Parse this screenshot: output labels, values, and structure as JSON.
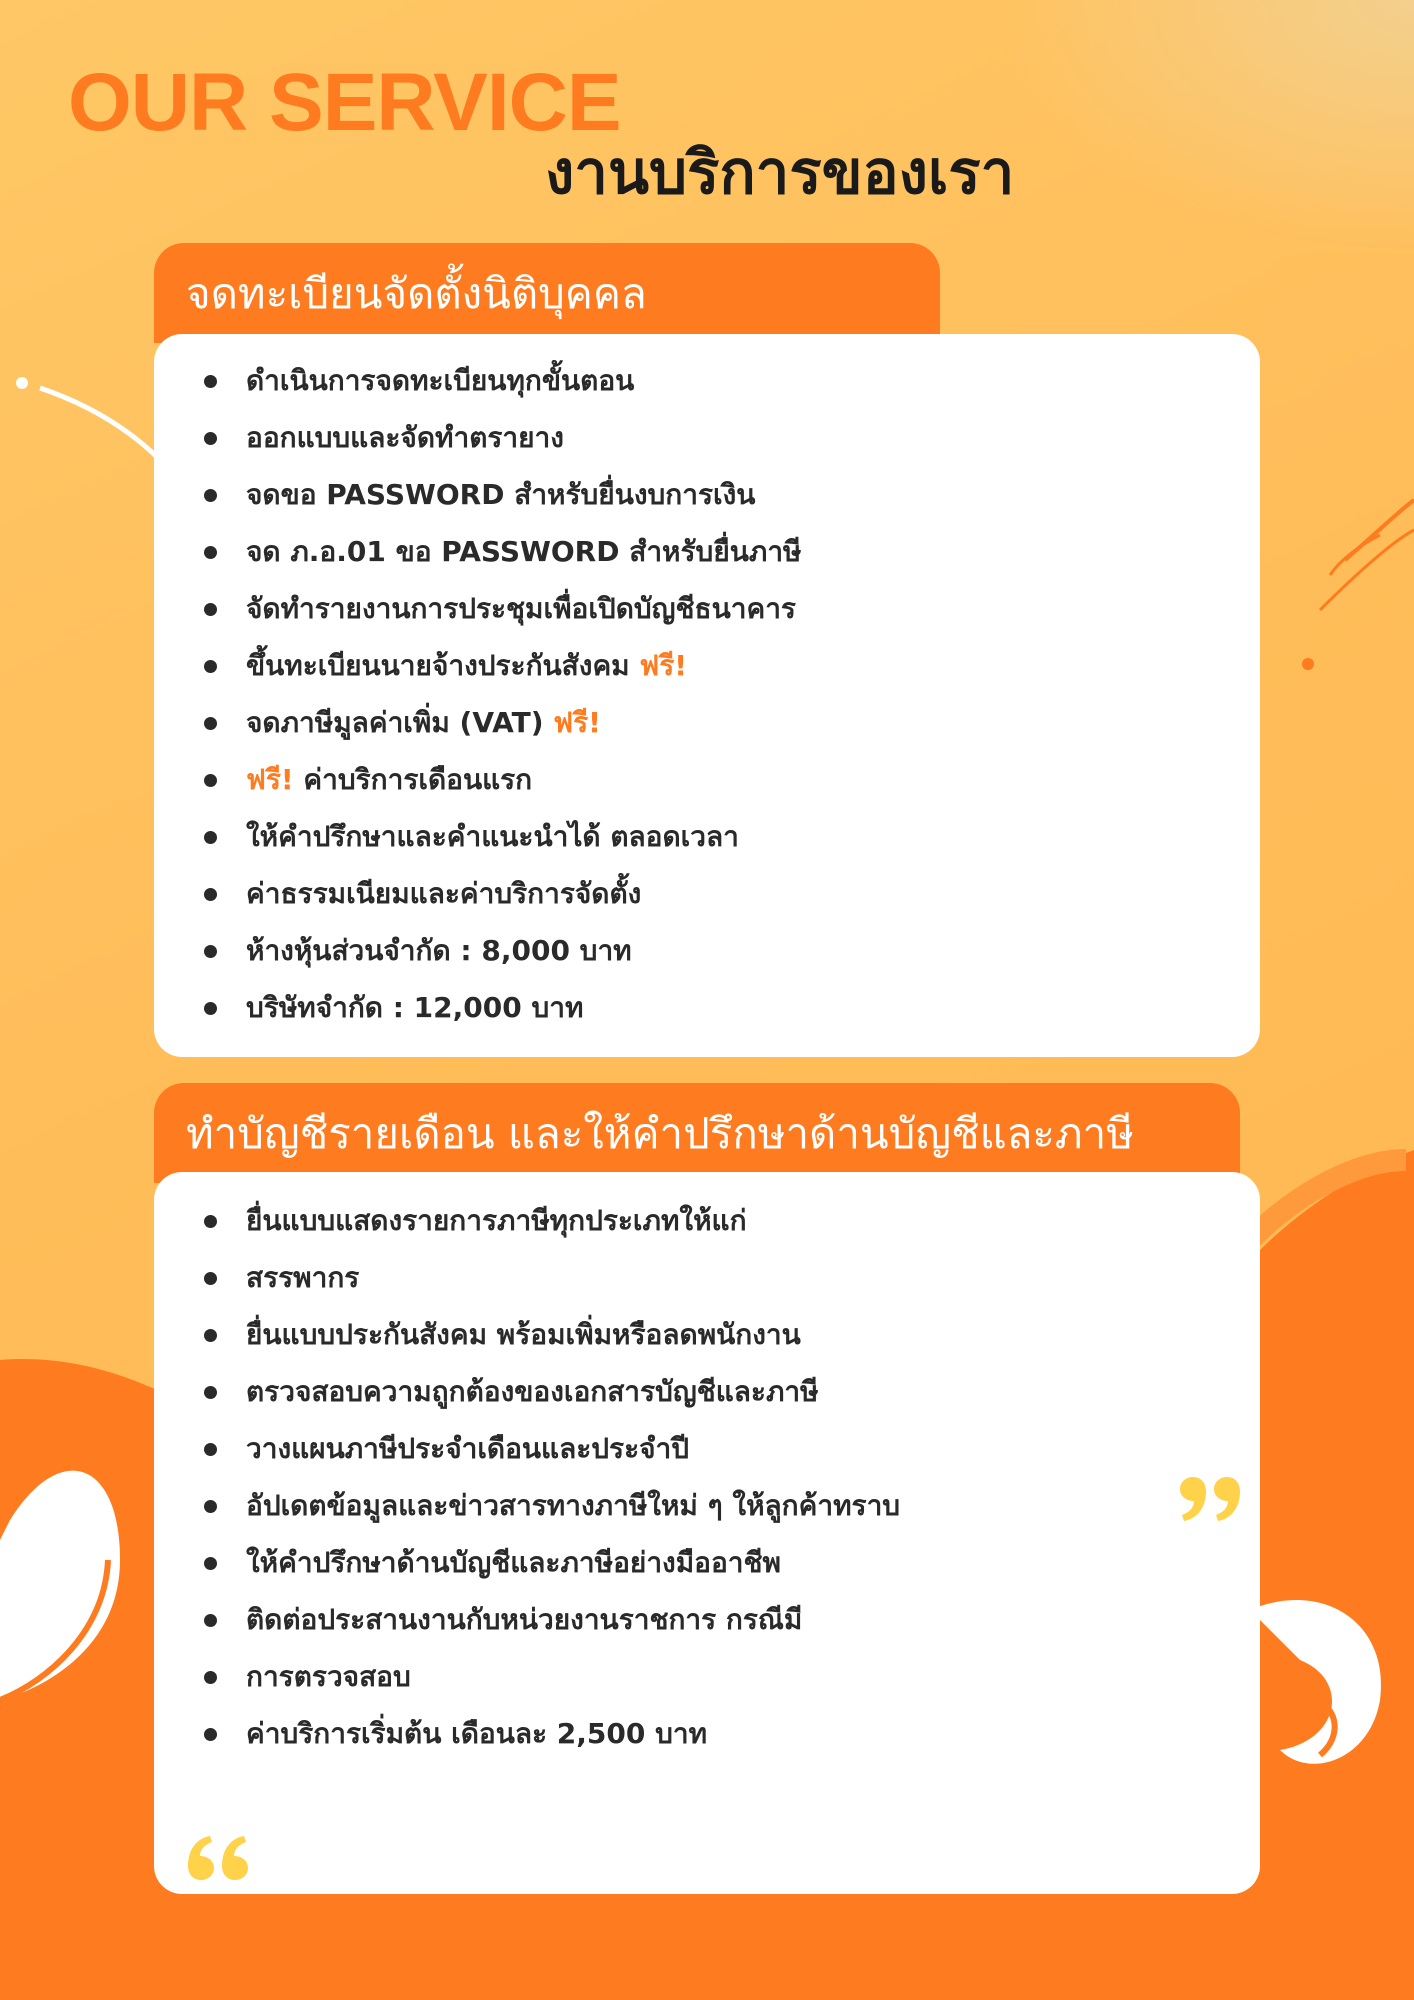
{
  "colors": {
    "accent": "#ff7b1f",
    "background": "#ffbd59",
    "text_dark": "#1a1a1a",
    "card": "#ffffff",
    "quote_yellow": "#ffd24a"
  },
  "header": {
    "title_en": "OUR SERVICE",
    "title_th": "งานบริการของเรา"
  },
  "section1": {
    "title": "จดทะเบียนจัดตั้งนิติบุคคล",
    "items": [
      "ดำเนินการจดทะเบียนทุกขั้นตอน",
      "ออกแบบและจัดทำตรายาง",
      "จดขอ PASSWORD สำหรับยื่นงบการเงิน",
      "จด ภ.อ.01 ขอ PASSWORD สำหรับยื่นภาษี",
      "จัดทำรายงานการประชุมเพื่อเปิดบัญชีธนาคาร",
      "ขึ้นทะเบียนนายจ้างประกันสังคม",
      "จดภาษีมูลค่าเพิ่ม (VAT)",
      "ค่าบริการเดือนแรก",
      "ให้คำปรึกษาและคำแนะนำได้ ตลอดเวลา",
      "ค่าธรรมเนียมและค่าบริการจัดตั้ง",
      "ห้างหุ้นส่วนจำกัด : 8,000 บาท",
      "บริษัทจำกัด : 12,000 บาท"
    ],
    "free_label": "ฟรี!"
  },
  "section2": {
    "title": "ทำบัญชีรายเดือน และให้คำปรึกษาด้านบัญชีและภาษี",
    "items": [
      "ยื่นแบบแสดงรายการภาษีทุกประเภทให้แก่",
      "สรรพากร",
      "ยื่นแบบประกันสังคม พร้อมเพิ่มหรือลดพนักงาน",
      "ตรวจสอบความถูกต้องของเอกสารบัญชีและภาษี",
      "วางแผนภาษีประจำเดือนและประจำปี",
      "อัปเดตข้อมูลและข่าวสารทางภาษีใหม่ ๆ ให้ลูกค้าทราบ",
      "ให้คำปรึกษาด้านบัญชีและภาษีอย่างมืออาชีพ",
      "ติดต่อประสานงานกับหน่วยงานราชการ กรณีมี",
      "การตรวจสอบ",
      "ค่าบริการเริ่มต้น เดือนละ 2,500 บาท"
    ]
  },
  "decor": {
    "open_quote_icon": "open-quote-icon",
    "close_quote_icon": "close-quote-icon"
  }
}
